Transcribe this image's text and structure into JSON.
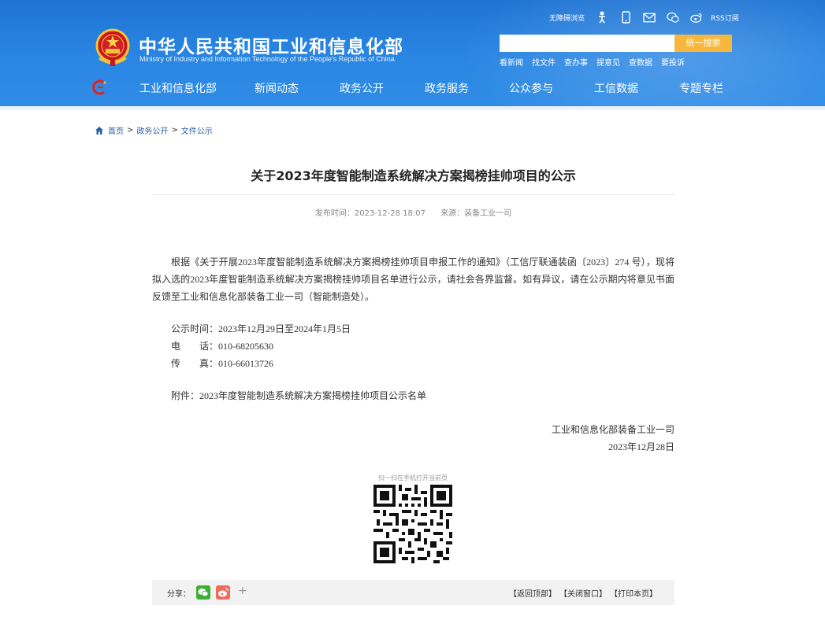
{
  "header": {
    "site_title": "中华人民共和国工业和信息化部",
    "site_subtitle": "Ministry of Industry and Information Technology of the People's Republic of China",
    "tools": {
      "accessibility": "无障碍浏览",
      "rss": "RSS订阅",
      "icons": [
        "accessibility-figure-icon",
        "mobile-icon",
        "mail-icon",
        "wechat-icon",
        "weibo-icon"
      ]
    },
    "search": {
      "placeholder": "",
      "button": "统一搜索"
    },
    "quick_links": [
      "看新闻",
      "找文件",
      "查办事",
      "提意见",
      "查数据",
      "要投诉"
    ],
    "nav": [
      "工业和信息化部",
      "新闻动态",
      "政务公开",
      "政务服务",
      "公众参与",
      "工信数据",
      "专题专栏"
    ]
  },
  "breadcrumb": {
    "items": [
      "首页",
      "政务公开",
      "文件公示"
    ],
    "separator": ">"
  },
  "article": {
    "title": "关于2023年度智能制造系统解决方案揭榜挂帅项目的公示",
    "publish_time": "发布时间：2023-12-28 18:07",
    "source": "来源：装备工业一司",
    "paragraph": "根据《关于开展2023年度智能制造系统解决方案揭榜挂帅项目申报工作的通知》（工信厅联通装函〔2023〕274 号），现将拟入选的2023年度智能制造系统解决方案揭榜挂帅项目名单进行公示，请社会各界监督。如有异议，请在公示期内将意见书面反馈至工业和信息化部装备工业一司（智能制造处）。",
    "period": "公示时间：2023年12月29日至2024年1月5日",
    "phone": "电　　话：010-68205630",
    "fax": "传　　真：010-66013726",
    "attachment": "附件：2023年度智能制造系统解决方案揭榜挂帅项目公示名单",
    "signer": "工业和信息化部装备工业一司",
    "date": "2023年12月28日",
    "qr_caption": "扫一扫在手机打开当前页"
  },
  "footer_bar": {
    "share_label": "分享：",
    "plus": "+",
    "links": [
      "【返回顶部】",
      "【关闭窗口】",
      "【打印本页】"
    ]
  },
  "colors": {
    "header_blue": "#2a86e3",
    "search_button": "#f6b73c",
    "link_blue": "#2a5faa"
  }
}
